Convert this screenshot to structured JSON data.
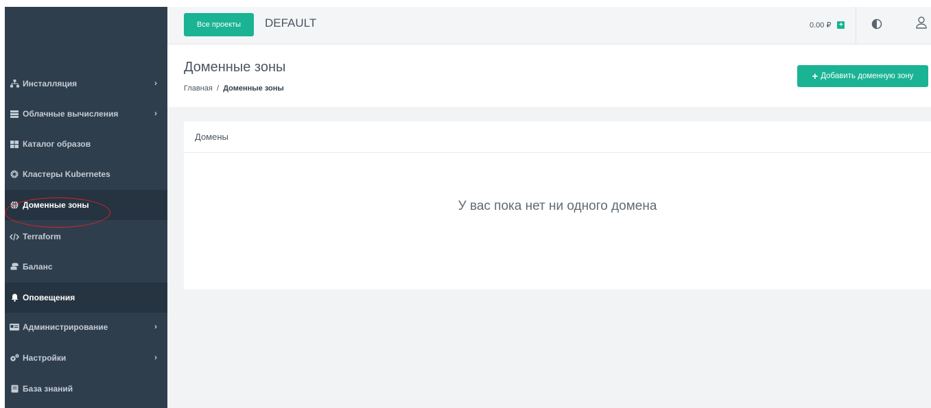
{
  "topbar": {
    "all_projects_label": "Все проекты",
    "project_name": "DEFAULT",
    "balance": "0.00 ₽"
  },
  "sidebar": {
    "items": [
      {
        "label": "Инсталляция",
        "icon": "sitemap-icon",
        "has_submenu": true
      },
      {
        "label": "Облачные вычисления",
        "icon": "server-icon",
        "has_submenu": true
      },
      {
        "label": "Каталог образов",
        "icon": "grid-icon",
        "has_submenu": false
      },
      {
        "label": "Кластеры Kubernetes",
        "icon": "kubernetes-icon",
        "has_submenu": false
      },
      {
        "label": "Доменные зоны",
        "icon": "globe-icon",
        "has_submenu": false,
        "active": true
      },
      {
        "label": "Terraform",
        "icon": "code-icon",
        "has_submenu": false
      },
      {
        "label": "Баланс",
        "icon": "coins-icon",
        "has_submenu": false
      },
      {
        "label": "Оповещения",
        "icon": "bell-icon",
        "has_submenu": false,
        "active": true
      },
      {
        "label": "Администрирование",
        "icon": "id-card-icon",
        "has_submenu": true
      },
      {
        "label": "Настройки",
        "icon": "gears-icon",
        "has_submenu": true
      },
      {
        "label": "База знаний",
        "icon": "book-icon",
        "has_submenu": false
      }
    ]
  },
  "page": {
    "title": "Доменные зоны",
    "breadcrumb_home": "Главная",
    "breadcrumb_sep": "/",
    "breadcrumb_current": "Доменные зоны",
    "add_button_label": "Добавить доменную зону"
  },
  "panel": {
    "title": "Домены",
    "empty_message": "У вас пока нет ни одного домена"
  },
  "colors": {
    "accent": "#1ab394",
    "sidebar_bg": "#2f3e4d",
    "sidebar_active_bg": "#263340",
    "highlight_oval": "#d9242b"
  }
}
